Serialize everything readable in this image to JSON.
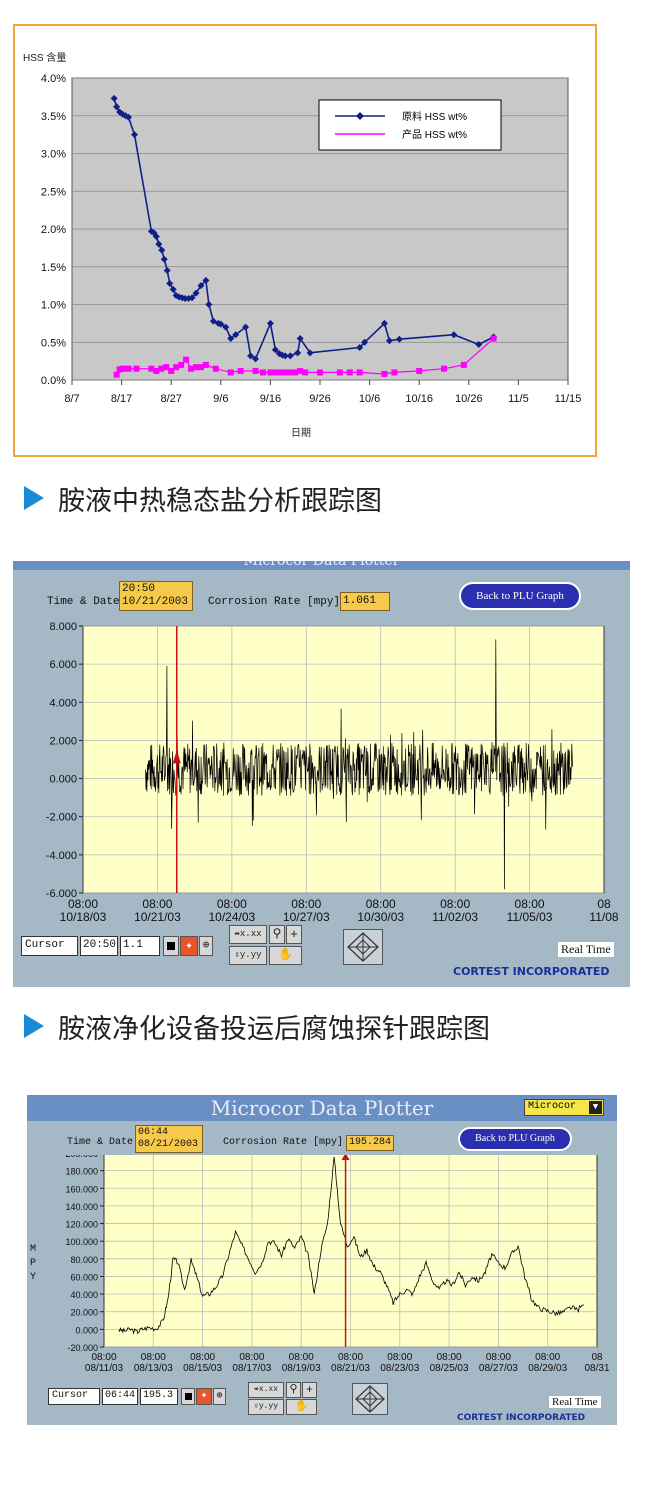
{
  "captions": {
    "caption1": "胺液中热稳态盐分析跟踪图",
    "caption2": "胺液净化设备投运后腐蚀探针跟踪图"
  },
  "chart_data": [
    {
      "type": "line",
      "ylabel": "HSS 含量",
      "xlabel": "日期",
      "x_ticks": [
        "8/7",
        "8/17",
        "8/27",
        "9/6",
        "9/16",
        "9/26",
        "10/6",
        "10/16",
        "10/26",
        "11/5",
        "11/15"
      ],
      "y_ticks": [
        "0.0%",
        "0.5%",
        "1.0%",
        "1.5%",
        "2.0%",
        "2.5%",
        "3.0%",
        "3.5%",
        "4.0%"
      ],
      "ylim": [
        0,
        4.0
      ],
      "xlim_days": [
        0,
        100
      ],
      "grid": true,
      "legend_position": "top-right",
      "series": [
        {
          "name": "原料 HSS wt%",
          "color": "#10208a",
          "marker": "diamond",
          "x": [
            8.5,
            9,
            9.6,
            10.2,
            10.8,
            11.4,
            12.6,
            16,
            16.5,
            17,
            17.5,
            18.1,
            18.6,
            19.2,
            19.7,
            20.4,
            21,
            21.6,
            22.2,
            22.8,
            23.5,
            24.2,
            25,
            26,
            27,
            27.6,
            28.5,
            29.5,
            30,
            31,
            32,
            33,
            35,
            36,
            37,
            40,
            41,
            41.8,
            42.4,
            43,
            44,
            45.5,
            46,
            48,
            58,
            59,
            63,
            64,
            66,
            77,
            82,
            85
          ],
          "y": [
            3.73,
            3.62,
            3.55,
            3.52,
            3.5,
            3.48,
            3.25,
            1.97,
            1.95,
            1.9,
            1.8,
            1.72,
            1.6,
            1.45,
            1.28,
            1.2,
            1.12,
            1.1,
            1.09,
            1.08,
            1.08,
            1.09,
            1.15,
            1.25,
            1.32,
            1.0,
            0.78,
            0.75,
            0.74,
            0.7,
            0.55,
            0.6,
            0.7,
            0.32,
            0.28,
            0.75,
            0.4,
            0.35,
            0.33,
            0.32,
            0.32,
            0.36,
            0.55,
            0.36,
            0.43,
            0.5,
            0.75,
            0.52,
            0.54,
            0.6,
            0.47,
            0.57
          ]
        },
        {
          "name": "产品 HSS wt%",
          "color": "#ff00ff",
          "marker": "square",
          "x": [
            9,
            9.6,
            10.2,
            10.8,
            11.4,
            13,
            16,
            17,
            18,
            19,
            20,
            21,
            22,
            23,
            24,
            25,
            26,
            27,
            29,
            32,
            34,
            37,
            38.5,
            40,
            41,
            42,
            43,
            44,
            45,
            46,
            47,
            50,
            54,
            56,
            58,
            63,
            65,
            70,
            75,
            79,
            85
          ],
          "y": [
            0.07,
            0.14,
            0.15,
            0.15,
            0.15,
            0.15,
            0.15,
            0.12,
            0.15,
            0.17,
            0.12,
            0.17,
            0.2,
            0.27,
            0.15,
            0.17,
            0.17,
            0.2,
            0.15,
            0.1,
            0.12,
            0.12,
            0.1,
            0.1,
            0.1,
            0.1,
            0.1,
            0.1,
            0.1,
            0.12,
            0.1,
            0.1,
            0.1,
            0.1,
            0.1,
            0.08,
            0.1,
            0.12,
            0.15,
            0.2,
            0.55
          ]
        }
      ]
    },
    {
      "type": "line",
      "title": "Microcor Data Plotter",
      "ylabel": "",
      "y_ticks": [
        "8.000",
        "6.000",
        "4.000",
        "2.000",
        "0.000",
        "-2.000",
        "-4.000",
        "-6.000"
      ],
      "ylim": [
        -6,
        8
      ],
      "x_ticks_time": [
        "08:00",
        "08:00",
        "08:00",
        "08:00",
        "08:00",
        "08:00",
        "08:00",
        "08"
      ],
      "x_ticks_date": [
        "10/18/03",
        "10/21/03",
        "10/24/03",
        "10/27/03",
        "10/30/03",
        "11/02/03",
        "11/05/03",
        "11/08"
      ],
      "grid": true,
      "series": [
        {
          "name": "",
          "color": "#000000",
          "description_values": "noisy around 0.5, spikes to 7.3 near 11/05"
        }
      ],
      "cursor_position_fraction": 0.18
    },
    {
      "type": "line",
      "title": "Microcor Data Plotter",
      "ylabel": "MPY",
      "y_ticks": [
        "200.000",
        "180.000",
        "160.000",
        "140.000",
        "120.000",
        "100.000",
        "80.000",
        "60.000",
        "40.000",
        "20.000",
        "0.000",
        "-20.000"
      ],
      "ylim": [
        -20,
        200
      ],
      "x_ticks_time": [
        "08:00",
        "08:00",
        "08:00",
        "08:00",
        "08:00",
        "08:00",
        "08:00",
        "08:00",
        "08:00",
        "08:00",
        "08"
      ],
      "x_ticks_date": [
        "08/11/03",
        "08/13/03",
        "08/15/03",
        "08/17/03",
        "08/19/03",
        "08/21/03",
        "08/23/03",
        "08/25/03",
        "08/27/03",
        "08/29/03",
        "08/31"
      ],
      "grid": true,
      "series": [
        {
          "name": "",
          "color": "#000000",
          "x": [
            0.9,
            1.2,
            1.6,
            2,
            2.3,
            2.7,
            3.2,
            3.6,
            3.9,
            4.2,
            4.5,
            4.9,
            5.3,
            5.6,
            6,
            6.4,
            6.8,
            7.2,
            7.6,
            8,
            8.4,
            8.8,
            9.2,
            9.6,
            10,
            10.4,
            10.8,
            11.2,
            11.6,
            12,
            12.4,
            12.8,
            13.2,
            13.6,
            14,
            14.4,
            14.8,
            15.2,
            15.6,
            16,
            16.4,
            16.8,
            17.2,
            17.6,
            18,
            18.4,
            18.8,
            19.2,
            19.6,
            20,
            20.4,
            20.8,
            21.2,
            21.6,
            22,
            22.4,
            22.8,
            23.2,
            23.6,
            24,
            24.4,
            24.8,
            25.2,
            25.6,
            26,
            26.4,
            26.8,
            27.2,
            27.6,
            28,
            28.4,
            28.8,
            29.2
          ],
          "y": [
            0,
            -2,
            0,
            -3,
            0,
            2,
            1,
            10,
            35,
            80,
            76,
            45,
            78,
            62,
            38,
            40,
            48,
            60,
            85,
            110,
            95,
            80,
            65,
            75,
            100,
            98,
            84,
            103,
            92,
            105,
            85,
            40,
            90,
            120,
            195,
            120,
            95,
            105,
            82,
            90,
            72,
            65,
            50,
            30,
            40,
            45,
            40,
            60,
            75,
            55,
            45,
            55,
            50,
            65,
            50,
            60,
            55,
            65,
            85,
            75,
            70,
            85,
            95,
            60,
            35,
            25,
            22,
            20,
            18,
            20,
            25,
            22,
            28
          ]
        }
      ],
      "cursor_position_fraction": 0.49
    }
  ],
  "plotter1": {
    "title": "Microcor Data Plotter",
    "time_date_label": "Time & Date",
    "time": "20:50",
    "date": "10/21/2003",
    "corrosion_label": "Corrosion Rate [mpy]",
    "corrosion_value": "1.061",
    "back_button": "Back to PLU Graph",
    "cursor_label": "Cursor",
    "cursor_time": "20:50",
    "cursor_value": "1.1",
    "real_time": "Real Time",
    "company": "CORTEST INCORPORATED",
    "tool_x": "x.xx",
    "tool_y": "y.yy",
    "plus": "+"
  },
  "plotter2": {
    "title": "Microcor Data Plotter",
    "dropdown": "Microcor",
    "time_date_label": "Time & Date",
    "time": "06:44",
    "date": "08/21/2003",
    "corrosion_label": "Corrosion Rate [mpy]",
    "corrosion_value": "195.284",
    "back_button": "Back to PLU Graph",
    "cursor_label": "Cursor",
    "cursor_time": "06:44",
    "cursor_value": "195.3",
    "real_time": "Real Time",
    "company": "CORTEST INCORPORATED",
    "tool_x": "x.xx",
    "tool_y": "y.yy",
    "plus": "+",
    "ylabel_letters": [
      "M",
      "P",
      "Y"
    ]
  }
}
